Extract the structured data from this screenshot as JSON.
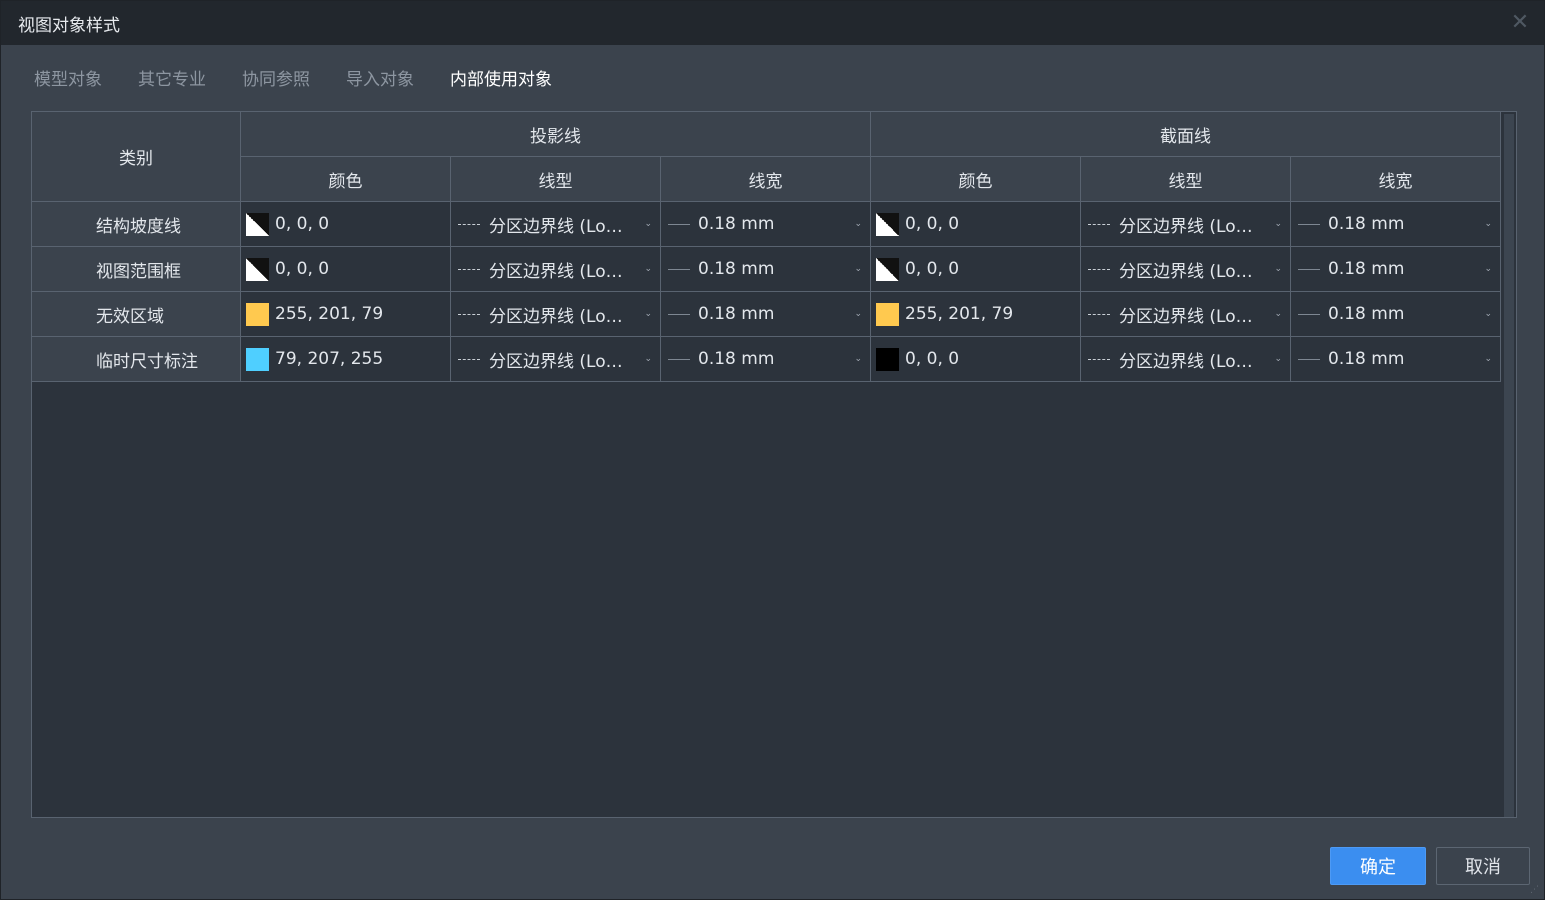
{
  "window": {
    "title": "视图对象样式",
    "close_icon": "close-icon"
  },
  "tabs": [
    {
      "label": "模型对象",
      "active": false
    },
    {
      "label": "其它专业",
      "active": false
    },
    {
      "label": "协同参照",
      "active": false
    },
    {
      "label": "导入对象",
      "active": false
    },
    {
      "label": "内部使用对象",
      "active": true
    }
  ],
  "table": {
    "headers": {
      "category": "类别",
      "projection": "投影线",
      "section": "截面线",
      "color": "颜色",
      "linetype": "线型",
      "linewidth": "线宽"
    },
    "rows": [
      {
        "category": "结构坡度线",
        "proj": {
          "color": "0, 0, 0",
          "swatch": "diag",
          "linetype": "分区边界线 (Lo…",
          "linewidth": "0.18 mm"
        },
        "sect": {
          "color": "0, 0, 0",
          "swatch": "diag",
          "linetype": "分区边界线 (Lo…",
          "linewidth": "0.18 mm"
        }
      },
      {
        "category": "视图范围框",
        "proj": {
          "color": "0, 0, 0",
          "swatch": "diag",
          "linetype": "分区边界线 (Lo…",
          "linewidth": "0.18 mm"
        },
        "sect": {
          "color": "0, 0, 0",
          "swatch": "diag",
          "linetype": "分区边界线 (Lo…",
          "linewidth": "0.18 mm"
        }
      },
      {
        "category": "无效区域",
        "proj": {
          "color": "255, 201, 79",
          "swatch": "#ffc94f",
          "linetype": "分区边界线 (Lo…",
          "linewidth": "0.18 mm"
        },
        "sect": {
          "color": "255, 201, 79",
          "swatch": "#ffc94f",
          "linetype": "分区边界线 (Lo…",
          "linewidth": "0.18 mm"
        }
      },
      {
        "category": "临时尺寸标注",
        "proj": {
          "color": "79, 207, 255",
          "swatch": "#4fcfff",
          "linetype": "分区边界线 (Lo…",
          "linewidth": "0.18 mm"
        },
        "sect": {
          "color": "0, 0, 0",
          "swatch": "#000000",
          "linetype": "分区边界线 (Lo…",
          "linewidth": "0.18 mm"
        }
      }
    ]
  },
  "buttons": {
    "ok": "确定",
    "cancel": "取消"
  },
  "colors": {
    "accent": "#3b8ef0",
    "background": "#3b434d",
    "titlebar": "#22272d"
  }
}
